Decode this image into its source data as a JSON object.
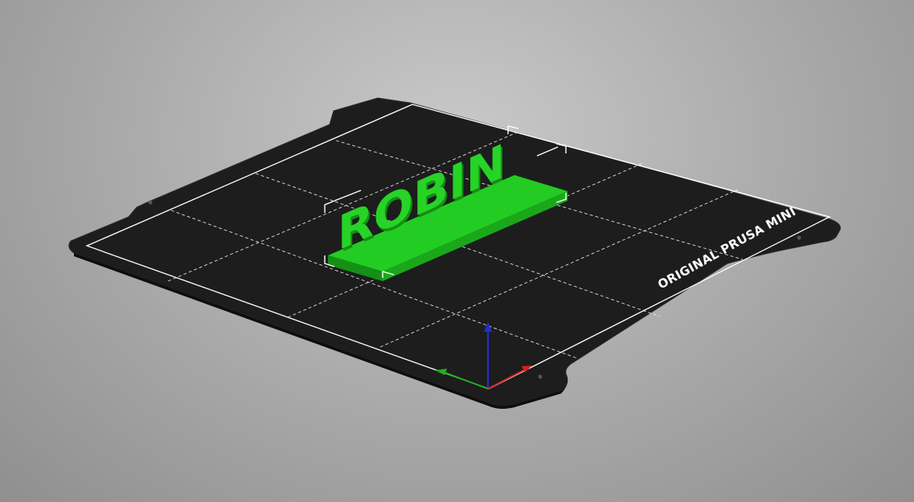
{
  "scene": {
    "bed_label": "ORIGINAL PRUSA MINI",
    "model_text": "ROBIN"
  },
  "colors": {
    "background": "#a8a8a8",
    "bed": "#1c1c1c",
    "bed_grid": "#ffffff",
    "model": "#22cc22",
    "model_shadow": "#149114",
    "bounding_box": "#ffffff",
    "axis_x": "#d42020",
    "axis_y": "#20b020",
    "axis_z": "#2030d0"
  },
  "axes": [
    "x-axis",
    "y-axis",
    "z-axis"
  ]
}
